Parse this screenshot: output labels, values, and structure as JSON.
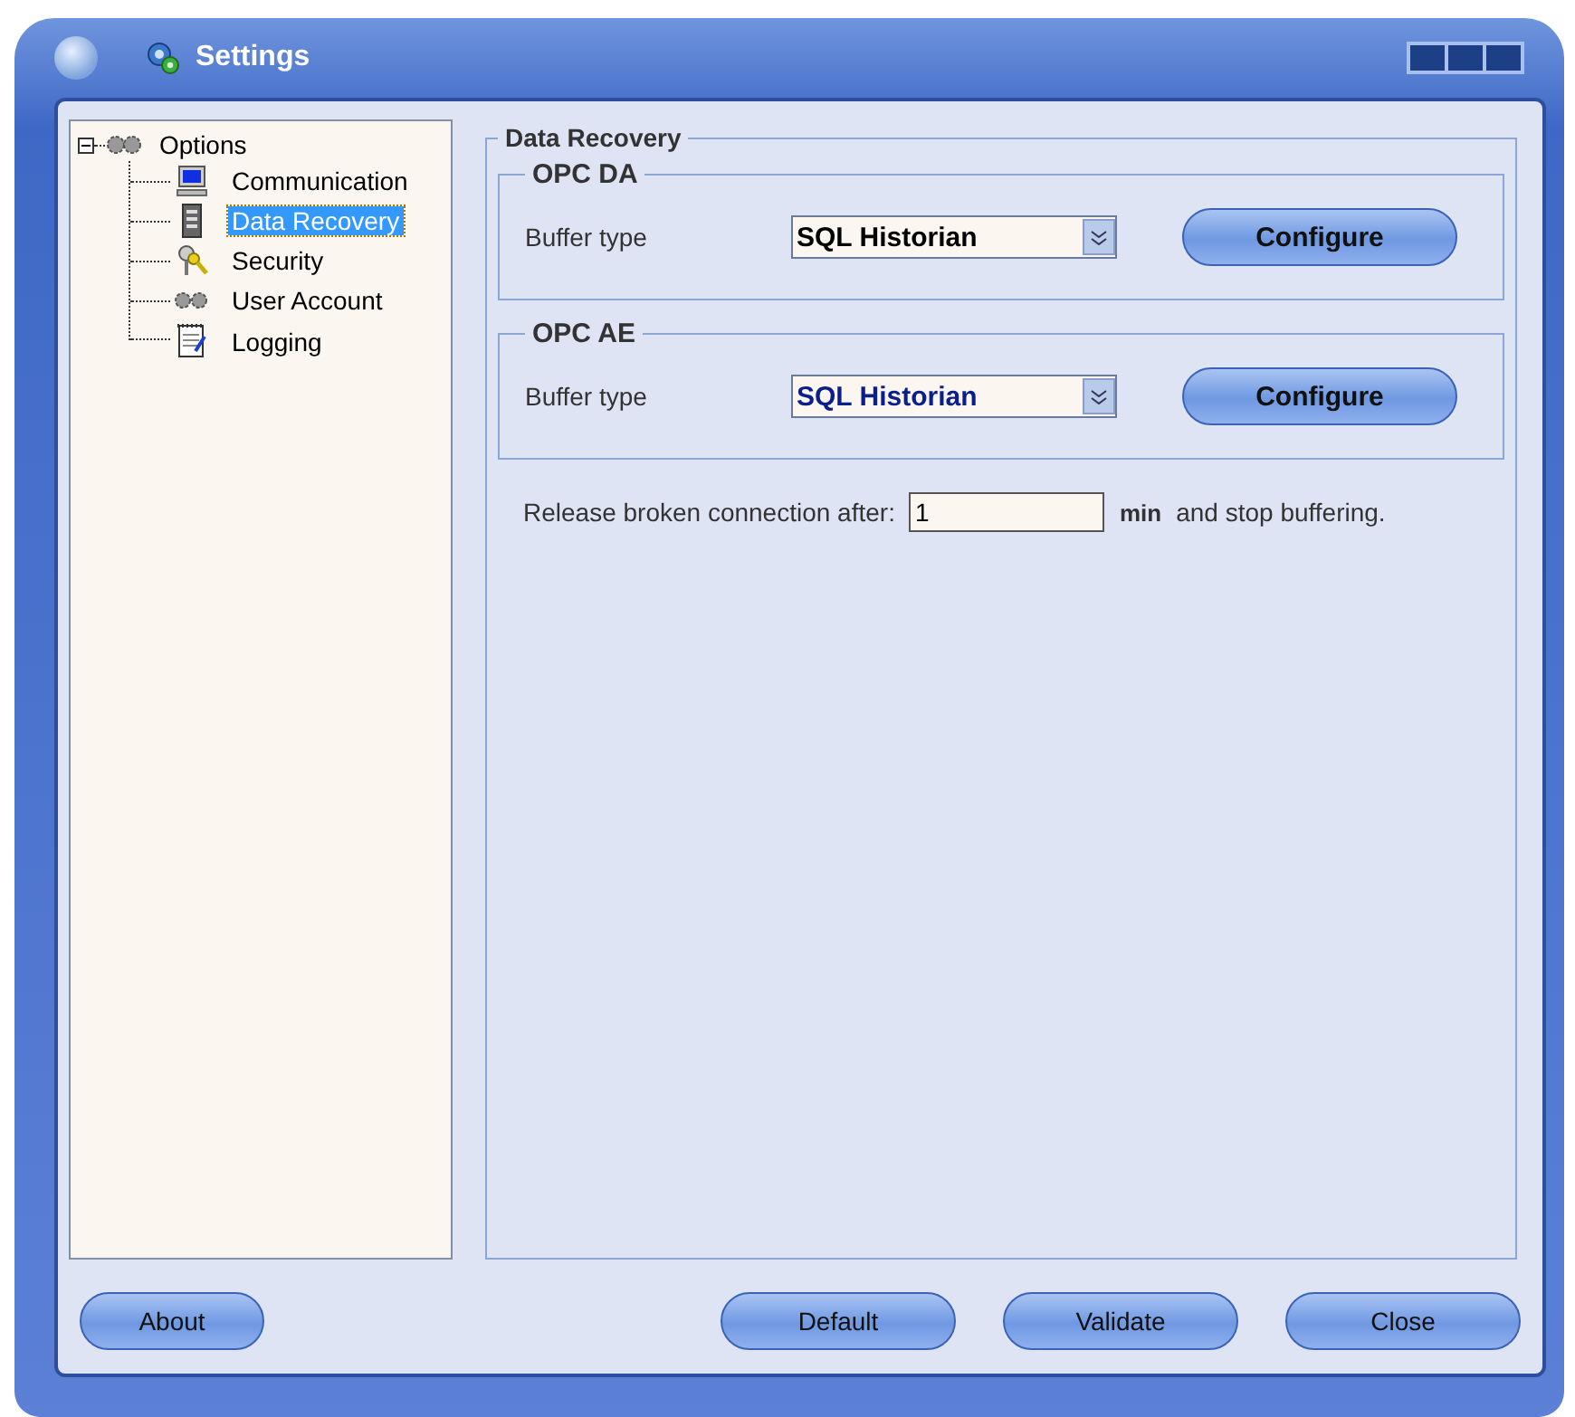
{
  "window": {
    "title": "Settings"
  },
  "tree": {
    "label": "Options",
    "expanded": true,
    "children": [
      {
        "label": "Communication",
        "selected": false
      },
      {
        "label": "Data Recovery",
        "selected": true
      },
      {
        "label": "Security",
        "selected": false
      },
      {
        "label": "User Account",
        "selected": false
      },
      {
        "label": "Logging",
        "selected": false
      }
    ]
  },
  "panel": {
    "title": "Data Recovery",
    "groups": [
      {
        "title": "OPC DA",
        "label": "Buffer type",
        "value": "SQL Historian",
        "focused": false,
        "button": "Configure"
      },
      {
        "title": "OPC AE",
        "label": "Buffer type",
        "value": "SQL Historian",
        "focused": true,
        "button": "Configure"
      }
    ],
    "release": {
      "label": "Release broken connection after:",
      "value": "1",
      "unit": "min",
      "suffix": "and stop buffering."
    }
  },
  "buttons_left": [
    "About"
  ],
  "buttons_right": [
    "Default",
    "Validate",
    "Close"
  ]
}
